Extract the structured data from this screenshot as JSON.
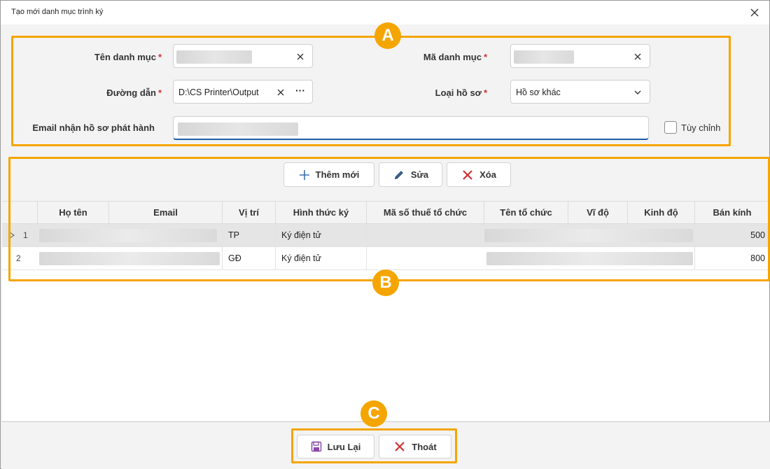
{
  "window": {
    "title": "Tạo mới danh mục trình ký"
  },
  "form": {
    "ten_danh_muc_label": "Tên danh mục",
    "ma_danh_muc_label": "Mã danh mục",
    "duong_dan_label": "Đường dẫn",
    "duong_dan_value": "D:\\CS Printer\\Output",
    "loai_ho_so_label": "Loại hồ sơ",
    "loai_ho_so_value": "Hồ sơ khác",
    "email_label": "Email nhận hồ sơ phát hành",
    "tuy_chinh_label": "Tùy chỉnh",
    "required_mark": "*",
    "browse_glyph": "···"
  },
  "toolbar": {
    "add_label": "Thêm mới",
    "edit_label": "Sửa",
    "delete_label": "Xóa"
  },
  "table": {
    "columns": [
      "Họ tên",
      "Email",
      "Vị trí",
      "Hình thức ký",
      "Mã số thuế tổ chức",
      "Tên tổ chức",
      "Vĩ độ",
      "Kinh độ",
      "Bán kính"
    ],
    "rows": [
      {
        "num": "1",
        "vi_tri": "TP",
        "hinh_thuc": "Ký điện tử",
        "ban_kinh": "500"
      },
      {
        "num": "2",
        "vi_tri": "GĐ",
        "hinh_thuc": "Ký điện tử",
        "ban_kinh": "800"
      }
    ]
  },
  "footer": {
    "save_label": "Lưu Lại",
    "exit_label": "Thoát"
  },
  "callouts": {
    "a": "A",
    "b": "B",
    "c": "C"
  },
  "colors": {
    "accent": "#f5a500",
    "required": "#d13438",
    "delete": "#d13438",
    "save_icon": "#8b4aa8",
    "add_icon": "#3b6fb0"
  }
}
